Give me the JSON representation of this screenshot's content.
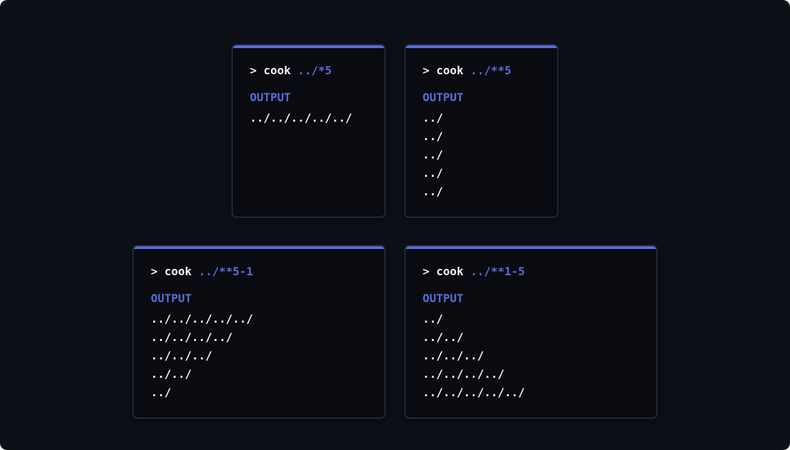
{
  "cards": [
    {
      "prompt": ">",
      "command": "cook",
      "argument": "../*5",
      "output_label": "OUTPUT",
      "output_lines": [
        "../../../../../"
      ]
    },
    {
      "prompt": ">",
      "command": "cook",
      "argument": "../**5",
      "output_label": "OUTPUT",
      "output_lines": [
        "../",
        "../",
        "../",
        "../",
        "../"
      ]
    },
    {
      "prompt": ">",
      "command": "cook",
      "argument": "../**5-1",
      "output_label": "OUTPUT",
      "output_lines": [
        "../../../../../",
        "../../../../",
        "../../../",
        "../../",
        "../"
      ]
    },
    {
      "prompt": ">",
      "command": "cook",
      "argument": "../**1-5",
      "output_label": "OUTPUT",
      "output_lines": [
        "../",
        "../../",
        "../../../",
        "../../../../",
        "../../../../../"
      ]
    }
  ],
  "colors": {
    "background": "#0d1017",
    "card_background": "#090b10",
    "accent": "#5b6bd6",
    "text": "#f2f3f7"
  }
}
